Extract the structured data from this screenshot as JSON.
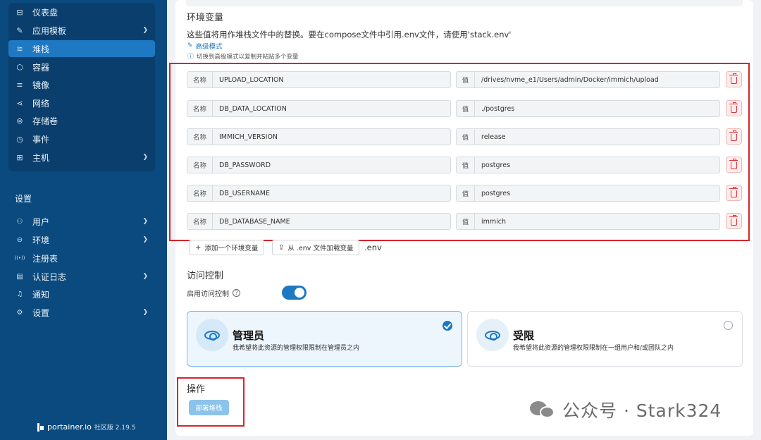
{
  "sidebar": {
    "nav_items": [
      {
        "icon": "dashboard-icon",
        "glyph": "⊟",
        "label": "仪表盘",
        "chevron": false,
        "active": false
      },
      {
        "icon": "template-icon",
        "glyph": "✎",
        "label": "应用模板",
        "chevron": true,
        "active": false
      },
      {
        "icon": "stack-icon",
        "glyph": "≋",
        "label": "堆栈",
        "chevron": false,
        "active": true
      },
      {
        "icon": "container-icon",
        "glyph": "⬡",
        "label": "容器",
        "chevron": false,
        "active": false
      },
      {
        "icon": "image-icon",
        "glyph": "≡",
        "label": "镜像",
        "chevron": false,
        "active": false
      },
      {
        "icon": "network-icon",
        "glyph": "⋖",
        "label": "网络",
        "chevron": false,
        "active": false
      },
      {
        "icon": "volume-icon",
        "glyph": "⊜",
        "label": "存储卷",
        "chevron": false,
        "active": false
      },
      {
        "icon": "event-icon",
        "glyph": "◷",
        "label": "事件",
        "chevron": false,
        "active": false
      },
      {
        "icon": "host-icon",
        "glyph": "⊞",
        "label": "主机",
        "chevron": true,
        "active": false
      }
    ],
    "settings_title": "设置",
    "settings_items": [
      {
        "icon": "user-icon",
        "glyph": "⚇",
        "label": "用户",
        "chevron": true
      },
      {
        "icon": "environment-icon",
        "glyph": "⊖",
        "label": "环境",
        "chevron": true
      },
      {
        "icon": "registry-icon",
        "glyph": "((•))",
        "label": "注册表",
        "chevron": false
      },
      {
        "icon": "auth-log-icon",
        "glyph": "▤",
        "label": "认证日志",
        "chevron": true
      },
      {
        "icon": "bell-icon",
        "glyph": "♫",
        "label": "通知",
        "chevron": false
      },
      {
        "icon": "gear-icon",
        "glyph": "⚙",
        "label": "设置",
        "chevron": true
      }
    ],
    "brand": {
      "name": "portainer.io",
      "edition": "社区版 2.19.5"
    }
  },
  "env": {
    "title": "环境变量",
    "description": "这些值将用作堆栈文件中的替换。要在compose文件中引用.env文件，请使用'stack.env'",
    "advanced_label": "高级模式",
    "advanced_hint": "切换到高级模式以复制并粘贴多个变量",
    "name_prefix": "名称",
    "value_prefix": "值",
    "rows": [
      {
        "name": "UPLOAD_LOCATION",
        "value": "/drives/nvme_e1/Users/admin/Docker/immich/upload"
      },
      {
        "name": "DB_DATA_LOCATION",
        "value": "./postgres"
      },
      {
        "name": "IMMICH_VERSION",
        "value": "release"
      },
      {
        "name": "DB_PASSWORD",
        "value": "postgres"
      },
      {
        "name": "DB_USERNAME",
        "value": "postgres"
      },
      {
        "name": "DB_DATABASE_NAME",
        "value": "immich"
      }
    ],
    "add_button": "添加一个环境变量",
    "load_button": "从 .env 文件加载变量",
    "suffix": ".env"
  },
  "access": {
    "title": "访问控制",
    "toggle_label": "启用访问控制",
    "toggle_on": true,
    "options": [
      {
        "title": "管理员",
        "desc": "我希望将此资源的管理权限限制在管理员之内",
        "selected": true
      },
      {
        "title": "受限",
        "desc": "我希望将此资源的管理权限限制在一组用户和/或团队之内",
        "selected": false
      }
    ]
  },
  "actions": {
    "title": "操作",
    "deploy_button": "部署堆栈"
  },
  "watermark": "公众号 · Stark324",
  "colors": {
    "sidebar": "#0b4a7e",
    "accent": "#1e78c2",
    "annotation_red": "#d9232a",
    "danger": "#d9363e"
  }
}
